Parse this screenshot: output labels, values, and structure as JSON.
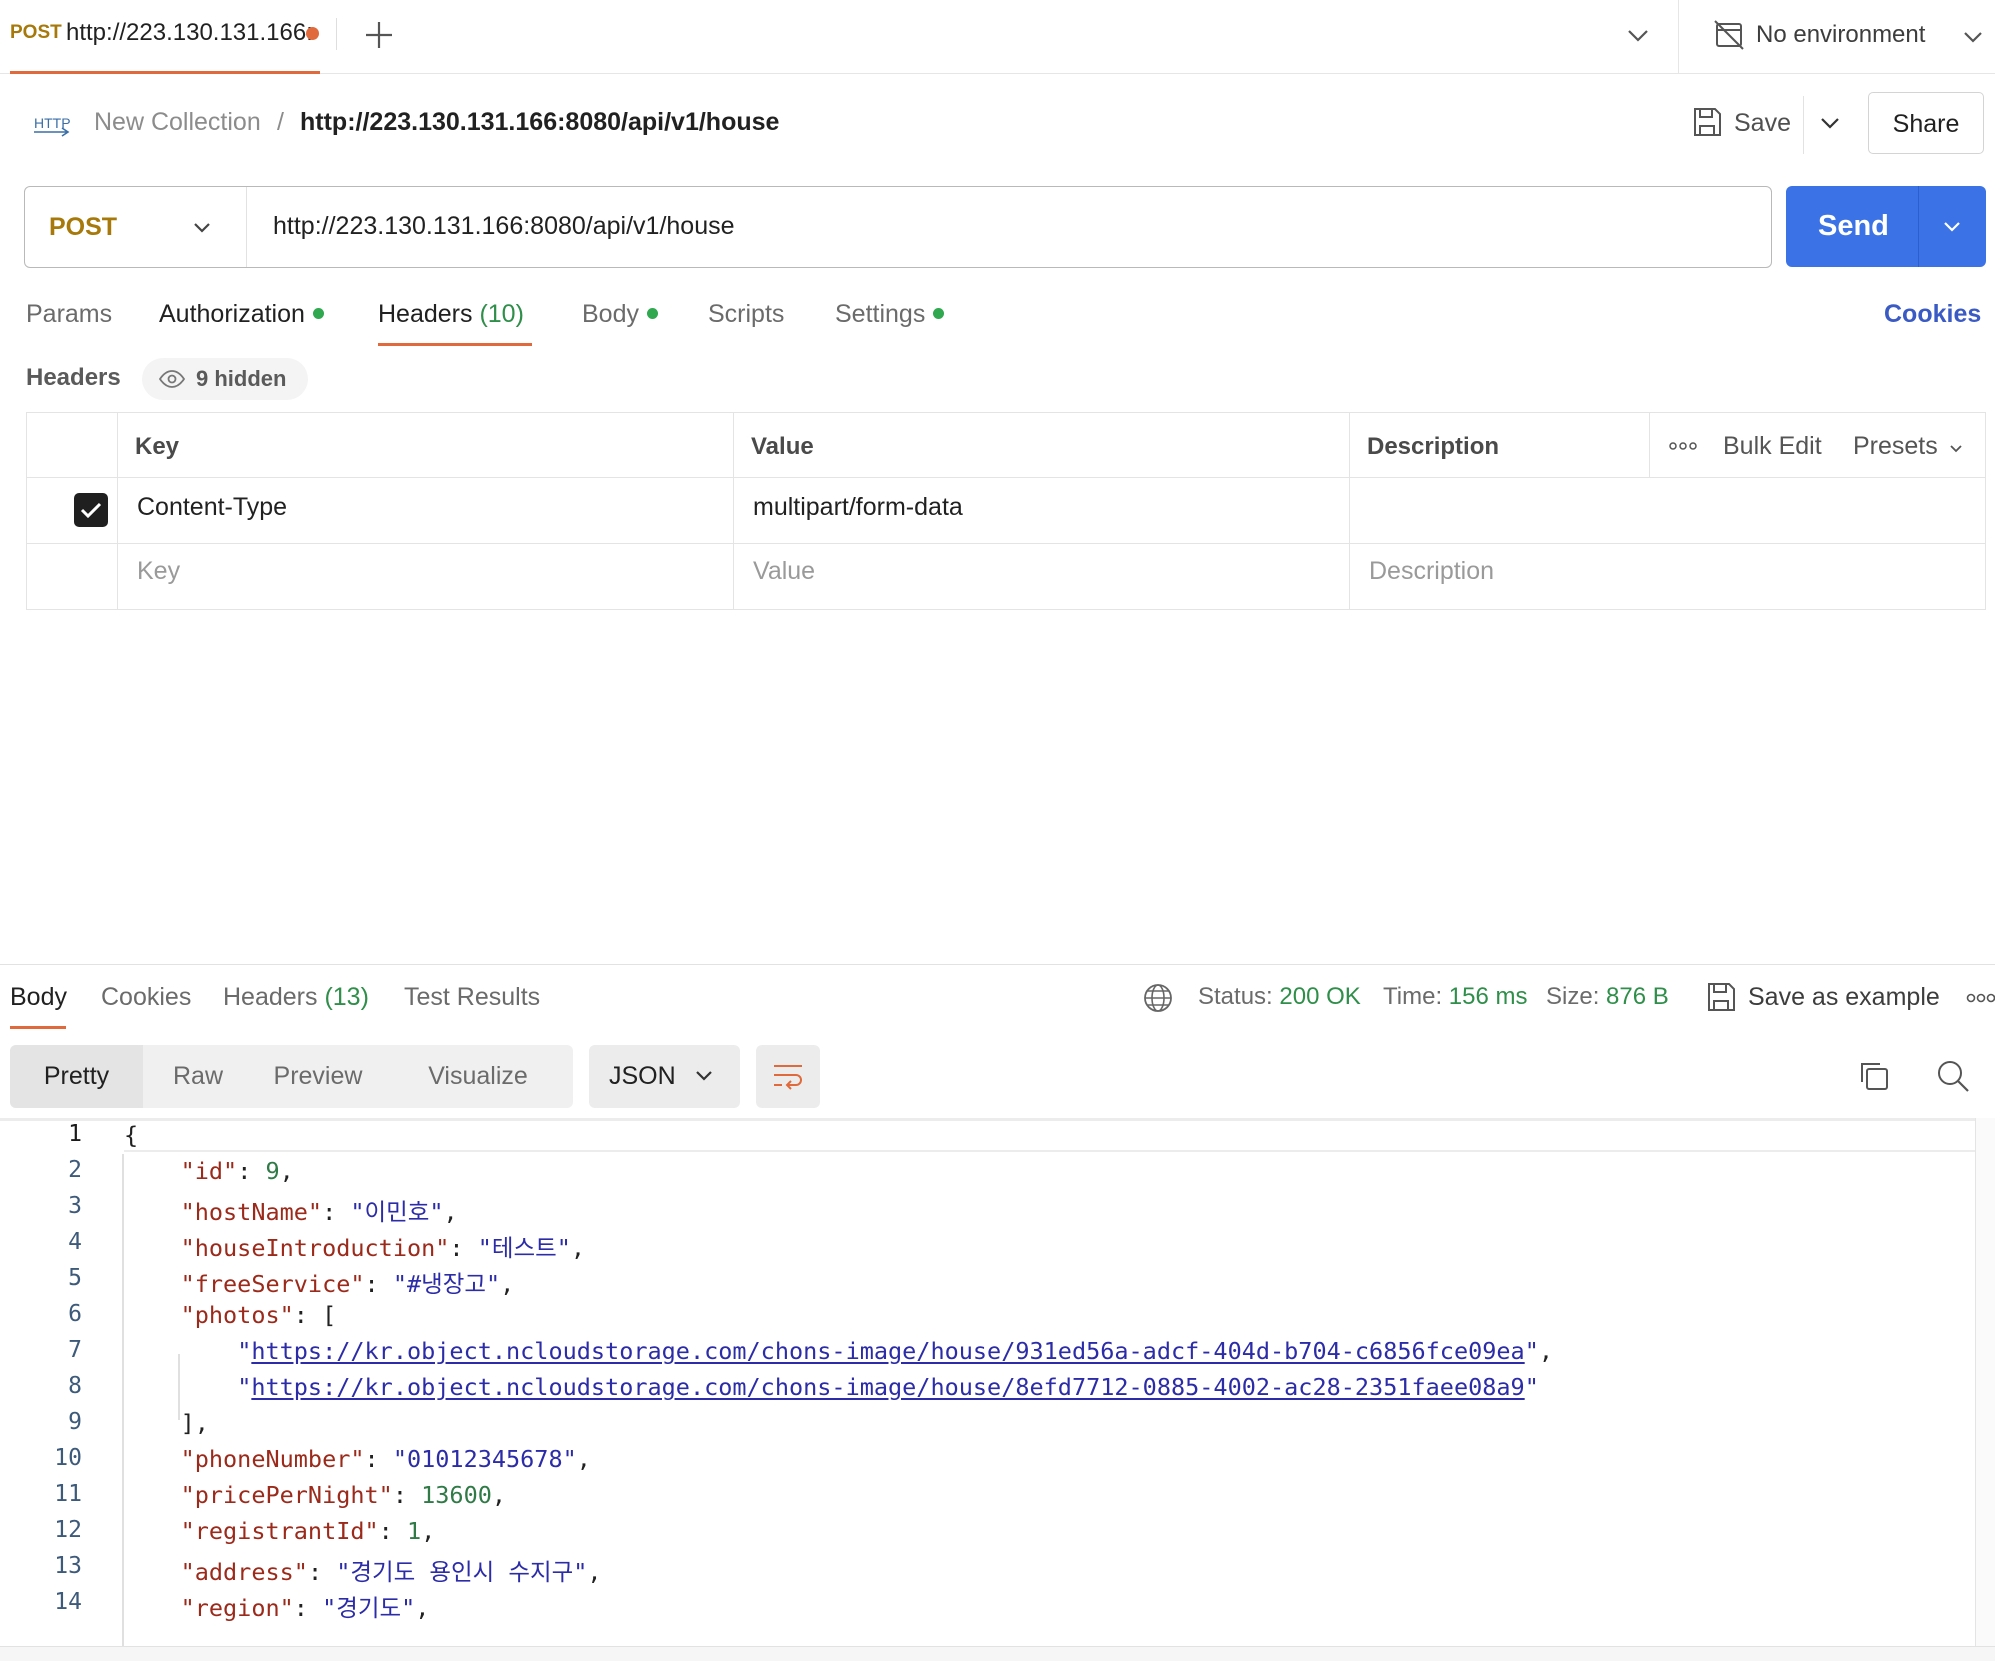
{
  "tabs": {
    "active": {
      "method": "POST",
      "url": "http://223.130.131.166:"
    }
  },
  "environment": {
    "label": "No environment"
  },
  "breadcrumb": {
    "icon_text": "HTTP",
    "collection": "New Collection",
    "separator": "/",
    "request": "http://223.130.131.166:8080/api/v1/house"
  },
  "toolbar": {
    "save_label": "Save",
    "share_label": "Share"
  },
  "request": {
    "method": "POST",
    "url": "http://223.130.131.166:8080/api/v1/house",
    "send_label": "Send"
  },
  "request_tabs": [
    {
      "label": "Params"
    },
    {
      "label": "Authorization"
    },
    {
      "label": "Headers",
      "count": "(10)"
    },
    {
      "label": "Body"
    },
    {
      "label": "Scripts"
    },
    {
      "label": "Settings"
    }
  ],
  "cookies_label": "Cookies",
  "headers": {
    "title": "Headers",
    "hidden_label": "9 hidden",
    "columns": {
      "key": "Key",
      "value": "Value",
      "description": "Description"
    },
    "bulk_edit": "Bulk Edit",
    "presets": "Presets",
    "rows": [
      {
        "enabled": true,
        "key": "Content-Type",
        "value": "multipart/form-data",
        "description": ""
      }
    ],
    "placeholders": {
      "key": "Key",
      "value": "Value",
      "description": "Description"
    }
  },
  "response": {
    "tabs": [
      {
        "label": "Body"
      },
      {
        "label": "Cookies"
      },
      {
        "label": "Headers",
        "count": "(13)"
      },
      {
        "label": "Test Results"
      }
    ],
    "status_label": "Status:",
    "status_value": "200 OK",
    "time_label": "Time:",
    "time_value": "156 ms",
    "size_label": "Size:",
    "size_value": "876 B",
    "save_example": "Save as example",
    "views": [
      "Pretty",
      "Raw",
      "Preview",
      "Visualize"
    ],
    "format": "JSON",
    "lines": [
      {
        "n": "1"
      },
      {
        "n": "2"
      },
      {
        "n": "3"
      },
      {
        "n": "4"
      },
      {
        "n": "5"
      },
      {
        "n": "6"
      },
      {
        "n": "7"
      },
      {
        "n": "8"
      },
      {
        "n": "9"
      },
      {
        "n": "10"
      },
      {
        "n": "11"
      },
      {
        "n": "12"
      },
      {
        "n": "13"
      },
      {
        "n": "14"
      }
    ],
    "json": {
      "open_brace": "{",
      "id_key": "\"id\"",
      "id_val": "9",
      "hostName_key": "\"hostName\"",
      "hostName_val": "\"이민호\"",
      "houseIntroduction_key": "\"houseIntroduction\"",
      "houseIntroduction_val": "\"테스트\"",
      "freeService_key": "\"freeService\"",
      "freeService_val": "\"#냉장고\"",
      "photos_key": "\"photos\"",
      "photo_1": "https://kr.object.ncloudstorage.com/chons-image/house/931ed56a-adcf-404d-b704-c6856fce09ea",
      "photo_2": "https://kr.object.ncloudstorage.com/chons-image/house/8efd7712-0885-4002-ac28-2351faee08a9",
      "phoneNumber_key": "\"phoneNumber\"",
      "phoneNumber_val": "\"01012345678\"",
      "pricePerNight_key": "\"pricePerNight\"",
      "pricePerNight_val": "13600",
      "registrantId_key": "\"registrantId\"",
      "registrantId_val": "1",
      "address_key": "\"address\"",
      "address_val": "\"경기도 용인시 수지구\"",
      "region_key": "\"region\"",
      "region_val": "\"경기도\""
    }
  },
  "colors": {
    "accent": "#e06a3b",
    "send": "#3b73e6",
    "method": "#a6790a",
    "status_ok": "#2f8f4a",
    "json_key": "#9b2a1b",
    "json_string": "#2c2ca8",
    "json_number": "#2f7a46"
  },
  "icons": [
    "plus-icon",
    "chevron-down-icon",
    "no-environment-icon",
    "http-icon",
    "save-icon",
    "eye-icon",
    "more-icon",
    "globe-icon",
    "wrap-icon",
    "copy-icon",
    "search-icon",
    "check-icon"
  ]
}
